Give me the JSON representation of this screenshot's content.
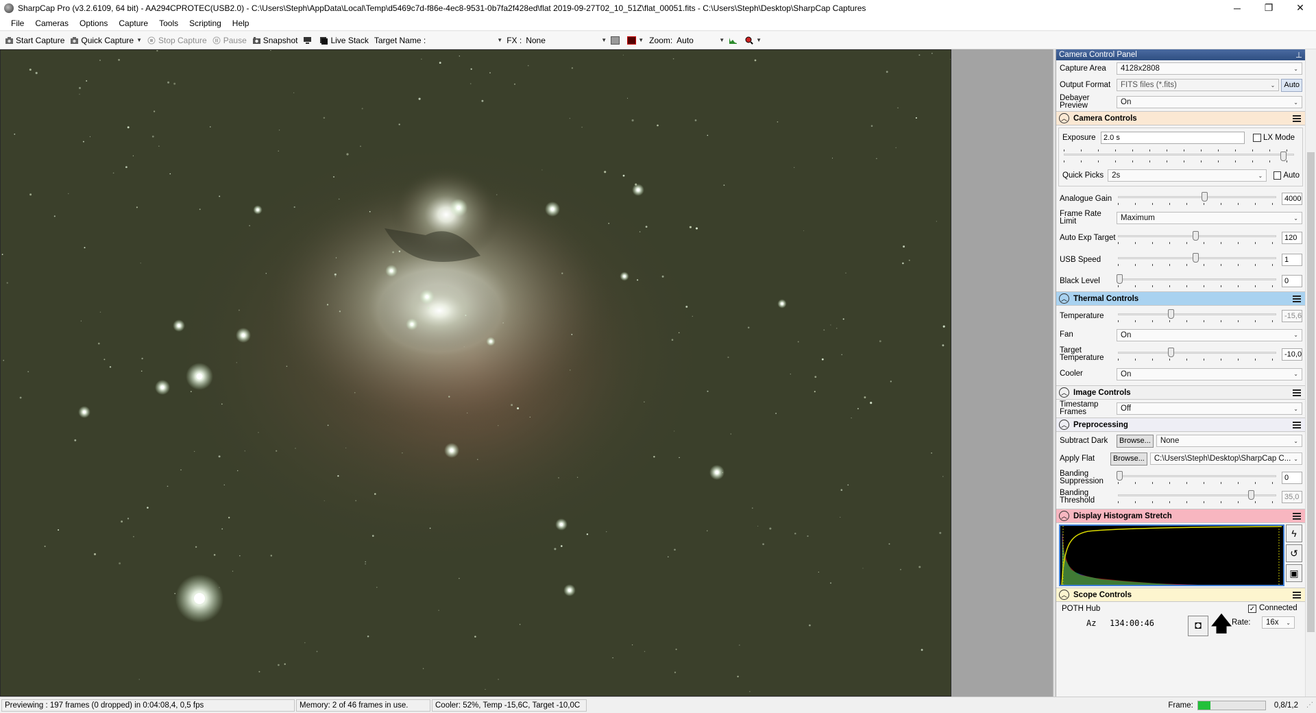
{
  "window": {
    "title": "SharpCap Pro (v3.2.6109, 64 bit) - AA294CPROTEC(USB2.0) - C:\\Users\\Steph\\AppData\\Local\\Temp\\d5469c7d-f86e-4ec8-9531-0b7fa2f428ed\\flat 2019-09-27T02_10_51Z\\flat_00051.fits - C:\\Users\\Steph\\Desktop\\SharpCap Captures",
    "minimize": "─",
    "restore": "❐",
    "close": "✕"
  },
  "menu": [
    "File",
    "Cameras",
    "Options",
    "Capture",
    "Tools",
    "Scripting",
    "Help"
  ],
  "toolbar": {
    "start_capture": "Start Capture",
    "quick_capture": "Quick Capture",
    "stop_capture": "Stop Capture",
    "pause": "Pause",
    "snapshot": "Snapshot",
    "live_stack": "Live Stack",
    "target_name_label": "Target Name :",
    "target_name_value": "",
    "fx_label": "FX :",
    "fx_value": "None",
    "zoom_label": "Zoom:",
    "zoom_value": "Auto"
  },
  "panel": {
    "title": "Camera Control Panel",
    "pin": "⊥",
    "capture_area_label": "Capture Area",
    "capture_area_value": "4128x2808",
    "output_format_label": "Output Format",
    "output_format_value": "FITS files (*.fits)",
    "auto_button": "Auto",
    "debayer_label": "Debayer Preview",
    "debayer_value": "On",
    "camera_controls": {
      "title": "Camera Controls",
      "exposure_label": "Exposure",
      "exposure_value": "2.0 s",
      "lx_mode_label": "LX Mode",
      "quick_picks_label": "Quick Picks",
      "quick_picks_value": "2s",
      "auto_label": "Auto",
      "analogue_gain_label": "Analogue Gain",
      "analogue_gain_value": "4000",
      "frame_rate_label": "Frame Rate Limit",
      "frame_rate_value": "Maximum",
      "auto_exp_label": "Auto Exp Target",
      "auto_exp_value": "120",
      "usb_speed_label": "USB Speed",
      "usb_speed_value": "1",
      "black_level_label": "Black Level",
      "black_level_value": "0"
    },
    "thermal_controls": {
      "title": "Thermal Controls",
      "temperature_label": "Temperature",
      "temperature_value": "-15,6",
      "fan_label": "Fan",
      "fan_value": "On",
      "target_temp_label": "Target Temperature",
      "target_temp_value": "-10,0",
      "cooler_label": "Cooler",
      "cooler_value": "On"
    },
    "image_controls": {
      "title": "Image Controls",
      "timestamp_label": "Timestamp Frames",
      "timestamp_value": "Off"
    },
    "preprocessing": {
      "title": "Preprocessing",
      "subtract_dark_label": "Subtract Dark",
      "browse": "Browse...",
      "subtract_dark_value": "None",
      "apply_flat_label": "Apply Flat",
      "apply_flat_value": "C:\\Users\\Steph\\Desktop\\SharpCap C...",
      "banding_supp_label": "Banding Suppression",
      "banding_supp_value": "0",
      "banding_thresh_label": "Banding Threshold",
      "banding_thresh_value": "35,0"
    },
    "histogram": {
      "title": "Display Histogram Stretch"
    },
    "scope_controls": {
      "title": "Scope Controls",
      "hub_label": "POTH Hub",
      "connected_label": "Connected",
      "az_label": "Az",
      "az_value": "134:00:46",
      "rate_label": "Rate:",
      "rate_value": "16x"
    }
  },
  "status": {
    "previewing": "Previewing : 197 frames (0 dropped) in 0:04:08,4, 0,5 fps",
    "memory": "Memory: 2 of 46 frames in use.",
    "cooler": "Cooler: 52%, Temp -15,6C, Target -10,0C",
    "frame_label": "Frame:",
    "frame_value": "0,8/1,2"
  },
  "sliders": {
    "exposure": 0.96,
    "analogue_gain": 0.55,
    "auto_exp_target": 0.49,
    "usb_speed": 0.49,
    "black_level": 0.0,
    "temperature": 0.33,
    "target_temperature": 0.33,
    "banding_suppression": 0.0,
    "banding_threshold": 0.85
  },
  "colors": {
    "thermal_header": "#a9d2f0",
    "camera_header": "#fbe8d3",
    "image_header": "#f0f0f0",
    "preprocessing_header": "#eeeef5",
    "histogram_header": "#f8b6c0",
    "scope_header": "#fdf5cf",
    "sky": "#3a3f2a",
    "frame_bar": "#22c03a"
  }
}
